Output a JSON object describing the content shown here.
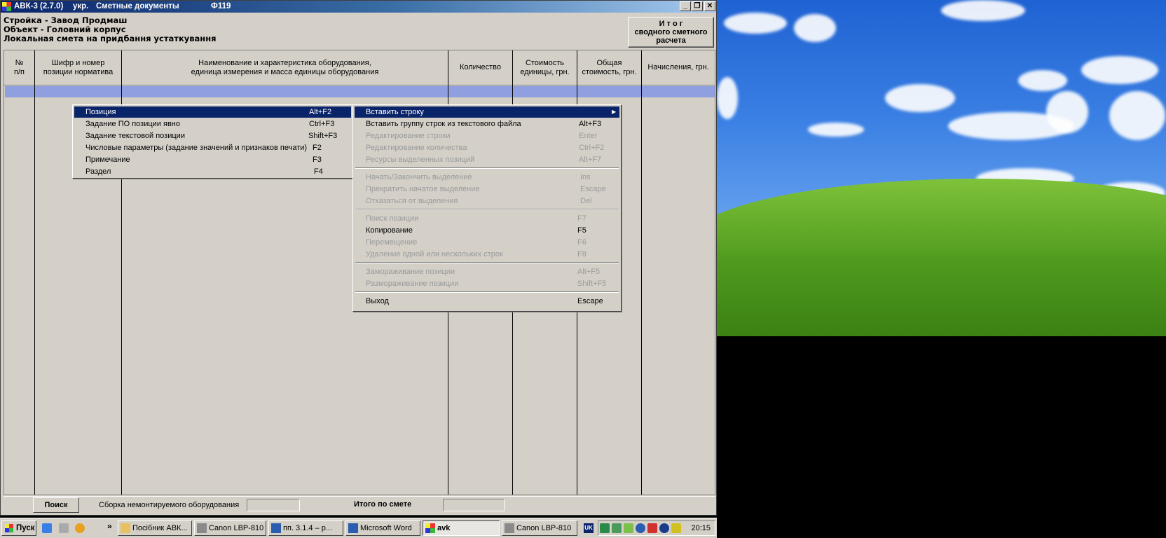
{
  "window": {
    "app": "АВК-3 (2.7.0)",
    "lang": "укр.",
    "doc": "Сметные документы",
    "form": "Ф119",
    "minimize": "_",
    "restore": "❐",
    "close": "✕"
  },
  "header": {
    "line1": "Стройка - Завод Продмаш",
    "line2": "Объект - Головний корпус",
    "line3": "Локальная смета на придбання устаткування",
    "summary_button": "И т о г\nсводного сметного\nрасчета"
  },
  "columns": [
    "№\nп/п",
    "Шифр и номер\nпозиции норматива",
    "Наименование и характеристика оборудования,\nединица измерения и масса единицы оборудования",
    "Количество",
    "Стоимость\nединицы, грн.",
    "Общая\nстоимость, грн.",
    "Начисления, грн."
  ],
  "left_menu": [
    {
      "label": "Позиция",
      "shortcut": "Alt+F2",
      "highlighted": true
    },
    {
      "label": "Задание ПО позиции явно",
      "shortcut": "Ctrl+F3"
    },
    {
      "label": "Задание текстовой позиции",
      "shortcut": "Shift+F3"
    },
    {
      "label": "Числовые параметры (задание значений и признаков печати)",
      "shortcut": "F2"
    },
    {
      "label": "Примечание",
      "shortcut": "F3"
    },
    {
      "label": "Раздел",
      "shortcut": "F4"
    }
  ],
  "right_menu": {
    "group1": [
      {
        "label": "Вставить строку",
        "shortcut": "",
        "highlighted": true,
        "submenu_arrow": "▶"
      },
      {
        "label": "Вставить группу строк из текстового файла",
        "shortcut": "Alt+F3"
      },
      {
        "label": "Редактирование строки",
        "shortcut": "Enter",
        "disabled": true
      },
      {
        "label": "Редактирование количества",
        "shortcut": "Ctrl+F2",
        "disabled": true
      },
      {
        "label": "Ресурсы выделенных позиций",
        "shortcut": "Alt+F7",
        "disabled": true
      }
    ],
    "group2": [
      {
        "label": "Начать/Закончить выделение",
        "shortcut": "Ins",
        "disabled": true
      },
      {
        "label": "Прекратить начатое выделение",
        "shortcut": "Escape",
        "disabled": true
      },
      {
        "label": "Отказаться от выделения",
        "shortcut": "Del",
        "disabled": true
      }
    ],
    "group3": [
      {
        "label": "Поиск позиции",
        "shortcut": "F7",
        "disabled": true
      },
      {
        "label": "Копирование",
        "shortcut": "F5"
      },
      {
        "label": "Перемещение",
        "shortcut": "F6",
        "disabled": true
      },
      {
        "label": "Удаление одной или нескольких строк",
        "shortcut": "F8",
        "disabled": true
      }
    ],
    "group4": [
      {
        "label": "Замораживание позиции",
        "shortcut": "Alt+F5",
        "disabled": true
      },
      {
        "label": "Размораживание позиции",
        "shortcut": "Shift+F5",
        "disabled": true
      }
    ],
    "group5": [
      {
        "label": "Выход",
        "shortcut": "Escape"
      }
    ]
  },
  "bottom": {
    "search_button": "Поиск",
    "assembly_label": "Сборка немонтируемого оборудования",
    "assembly_value": "",
    "total_label": "Итого по смете",
    "total_value": ""
  },
  "taskbar": {
    "start": "Пуск",
    "buttons": [
      {
        "label": "Посібник АВК...",
        "icon": "folder-icon"
      },
      {
        "label": "Canon LBP-810",
        "icon": "printer-icon"
      },
      {
        "label": "пп. 3.1.4 – р...",
        "icon": "word-doc-icon"
      },
      {
        "label": "Microsoft Word",
        "icon": "word-icon"
      },
      {
        "label": "avk",
        "icon": "avk-icon",
        "active": true
      },
      {
        "label": "Canon LBP-810",
        "icon": "printer-icon"
      }
    ],
    "lang": "UK",
    "clock": "20:15",
    "more": "»"
  }
}
